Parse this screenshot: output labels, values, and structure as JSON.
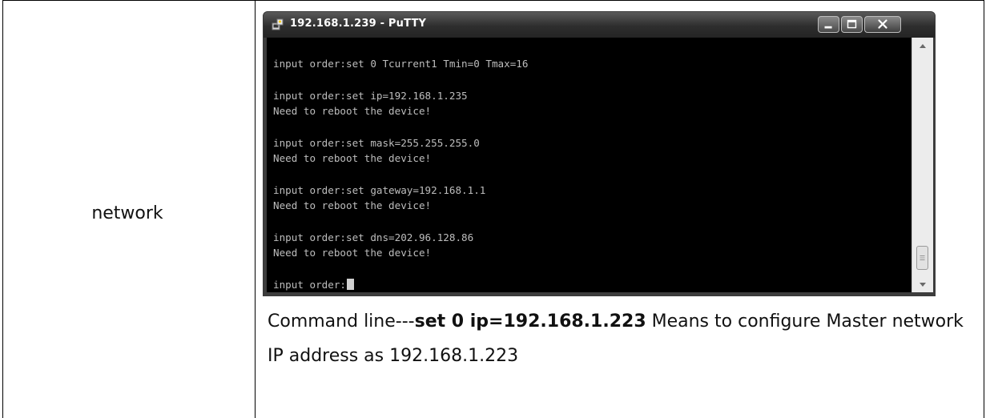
{
  "table": {
    "row_label": "network"
  },
  "putty": {
    "title": "192.168.1.239 - PuTTY",
    "icon": "putty-icon",
    "terminal_lines": [
      "input order:set 0 Tcurrent1 Tmin=0 Tmax=16",
      "input order:set ip=192.168.1.235",
      "Need to reboot the device!",
      "input order:set mask=255.255.255.0",
      "Need to reboot the device!",
      "input order:set gateway=192.168.1.1",
      "Need to reboot the device!",
      "input order:set dns=202.96.128.86",
      "Need to reboot the device!",
      "input order:"
    ]
  },
  "description": {
    "prefix": "Command line---",
    "command": "set 0 ip=192.168.1.223",
    "suffix": " Means to configure Master network IP address as 192.168.1.223"
  },
  "colors": {
    "terminal_bg": "#000000",
    "terminal_text": "#bdbdbd",
    "titlebar": "#2e2e2e"
  }
}
